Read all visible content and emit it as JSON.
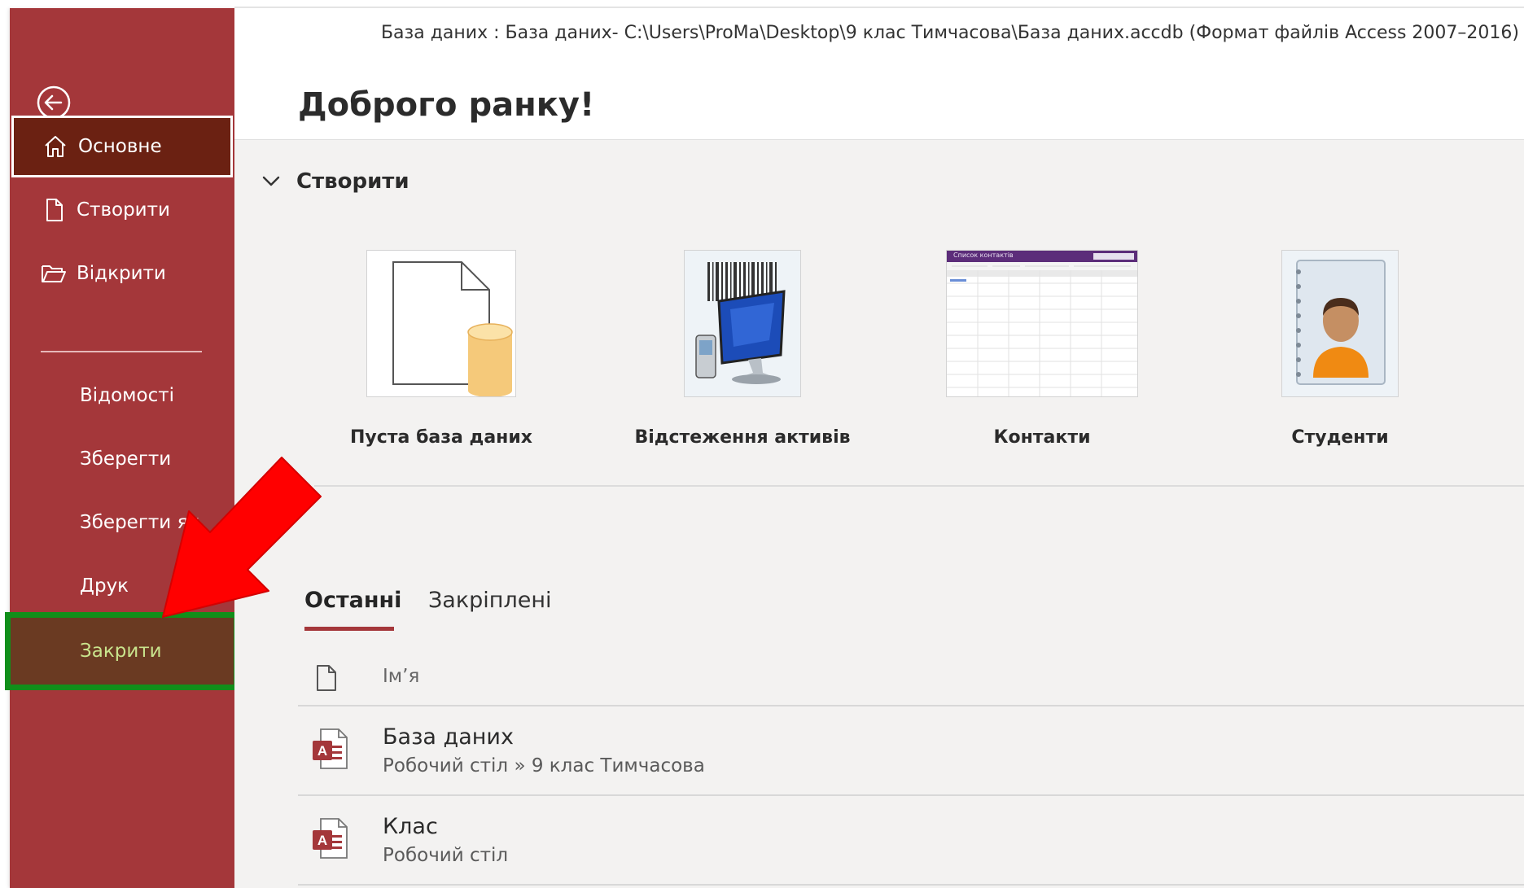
{
  "window": {
    "title": "База даних : База даних- C:\\Users\\ProMa\\Desktop\\9 клас Тимчасова\\База даних.accdb (Формат файлів Access 2007–2016)"
  },
  "greeting": "Доброго ранку!",
  "sidebar": {
    "items": [
      {
        "label": "Основне",
        "icon": "home-icon",
        "state": "selected"
      },
      {
        "label": "Створити",
        "icon": "new-document-icon"
      },
      {
        "label": "Відкрити",
        "icon": "open-folder-icon"
      },
      {
        "label": "Відомості"
      },
      {
        "label": "Зберегти"
      },
      {
        "label": "Зберегти як"
      },
      {
        "label": "Друк"
      },
      {
        "label": "Закрити",
        "state": "highlighted"
      }
    ],
    "accent_color": "#a4373a"
  },
  "create_section": {
    "title": "Створити",
    "templates": [
      {
        "label": "Пуста база даних"
      },
      {
        "label": "Відстеження активів"
      },
      {
        "label": "Контакти",
        "thumb_caption": "Список контактів"
      },
      {
        "label": "Студенти"
      }
    ]
  },
  "tabs": [
    {
      "label": "Останні",
      "active": true
    },
    {
      "label": "Закріплені",
      "active": false
    }
  ],
  "recent": {
    "column_name": "Ім’я",
    "files": [
      {
        "name": "База даних",
        "path": "Робочий стіл » 9 клас Тимчасова"
      },
      {
        "name": "Клас",
        "path": "Робочий стіл"
      }
    ]
  },
  "annotations": {
    "arrow_color": "#ff0000",
    "highlight_color": "#118f1a"
  }
}
